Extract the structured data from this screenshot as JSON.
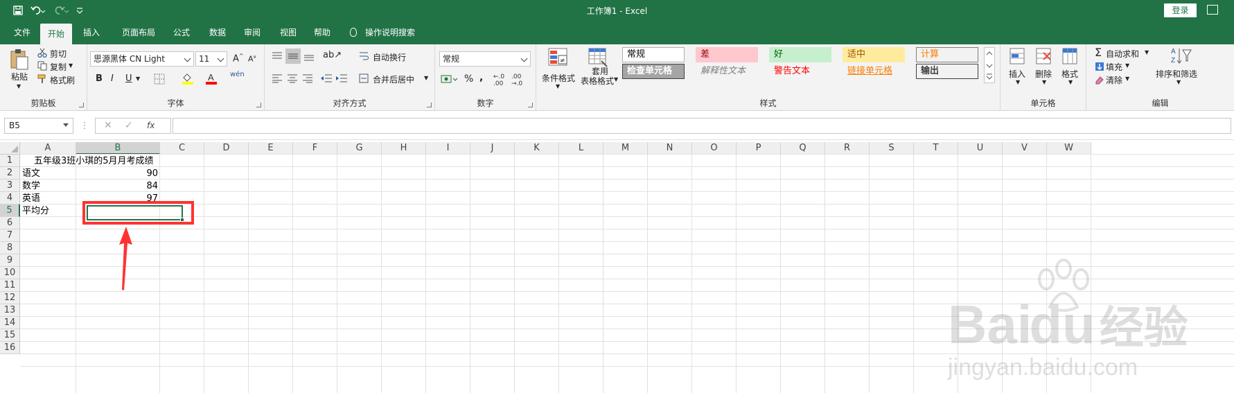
{
  "titlebar": {
    "title": "工作簿1  -  Excel",
    "login": "登录"
  },
  "tabs": [
    "文件",
    "开始",
    "插入",
    "页面布局",
    "公式",
    "数据",
    "审阅",
    "视图",
    "帮助"
  ],
  "active_tab": "开始",
  "tell_me": "操作说明搜索",
  "ribbon": {
    "clipboard": {
      "label": "剪贴板",
      "paste": "粘贴",
      "cut": "剪切",
      "copy": "复制",
      "format_painter": "格式刷"
    },
    "font": {
      "label": "字体",
      "font_name": "思源黑体 CN Light",
      "font_size": "11",
      "bold": "B",
      "italic": "I",
      "underline": "U"
    },
    "alignment": {
      "label": "对齐方式",
      "wrap_text": "自动换行",
      "merge_center": "合并后居中"
    },
    "number": {
      "label": "数字",
      "format": "常规",
      "percent": "%",
      "comma": ","
    },
    "styles": {
      "label": "样式",
      "conditional": "条件格式",
      "table_format_1": "套用",
      "table_format_2": "表格格式",
      "cells": [
        {
          "text": "常规",
          "bg": "#ffffff",
          "fg": "#000000",
          "border": "#b0b0b0"
        },
        {
          "text": "差",
          "bg": "#ffc7ce",
          "fg": "#9c0006",
          "border": "#ffc7ce"
        },
        {
          "text": "好",
          "bg": "#c6efce",
          "fg": "#006100",
          "border": "#c6efce"
        },
        {
          "text": "适中",
          "bg": "#ffeb9c",
          "fg": "#9c5700",
          "border": "#ffeb9c"
        },
        {
          "text": "计算",
          "bg": "#f2f2f2",
          "fg": "#fa7d00",
          "border": "#7f7f7f"
        },
        {
          "text": "检查单元格",
          "bg": "#a5a5a5",
          "fg": "#ffffff",
          "border": "#3f3f3f"
        },
        {
          "text": "解释性文本",
          "bg": "#f3f3f3",
          "fg": "#7f7f7f",
          "border": "#f3f3f3"
        },
        {
          "text": "警告文本",
          "bg": "#f3f3f3",
          "fg": "#ff0000",
          "border": "#f3f3f3"
        },
        {
          "text": "链接单元格",
          "bg": "#f3f3f3",
          "fg": "#fa7d00",
          "border": "#f3f3f3"
        },
        {
          "text": "输出",
          "bg": "#f2f2f2",
          "fg": "#3f3f3f",
          "border": "#3f3f3f"
        }
      ]
    },
    "cells_group": {
      "label": "单元格",
      "insert": "插入",
      "delete": "删除",
      "format": "格式"
    },
    "editing": {
      "label": "编辑",
      "autosum": "自动求和",
      "fill": "填充",
      "clear": "清除",
      "sort_filter": "排序和筛选"
    }
  },
  "formula_bar": {
    "name_box": "B5",
    "fx": "fx",
    "formula": ""
  },
  "columns": [
    "A",
    "B",
    "C",
    "D",
    "E",
    "F",
    "G",
    "H",
    "I",
    "J",
    "K",
    "L",
    "M",
    "N",
    "O",
    "P",
    "Q",
    "R",
    "S",
    "T",
    "U",
    "V",
    "W"
  ],
  "rows": [
    "1",
    "2",
    "3",
    "4",
    "5",
    "6",
    "7",
    "8",
    "9",
    "10",
    "11",
    "12",
    "13",
    "14",
    "15",
    "16"
  ],
  "selected_cell": "B5",
  "sheet": {
    "A1": "五年级3班小琪的5月月考成绩",
    "A2": "语文",
    "B2": "90",
    "A3": "数学",
    "B3": "84",
    "A4": "英语",
    "B4": "97",
    "A5": "平均分"
  },
  "watermark": {
    "brand_1": "Bai",
    "brand_2": "du",
    "brand_3": "经验",
    "url": "jingyan.baidu.com"
  },
  "colors": {
    "excel_green": "#217346",
    "annotation_red": "#ff3333"
  }
}
